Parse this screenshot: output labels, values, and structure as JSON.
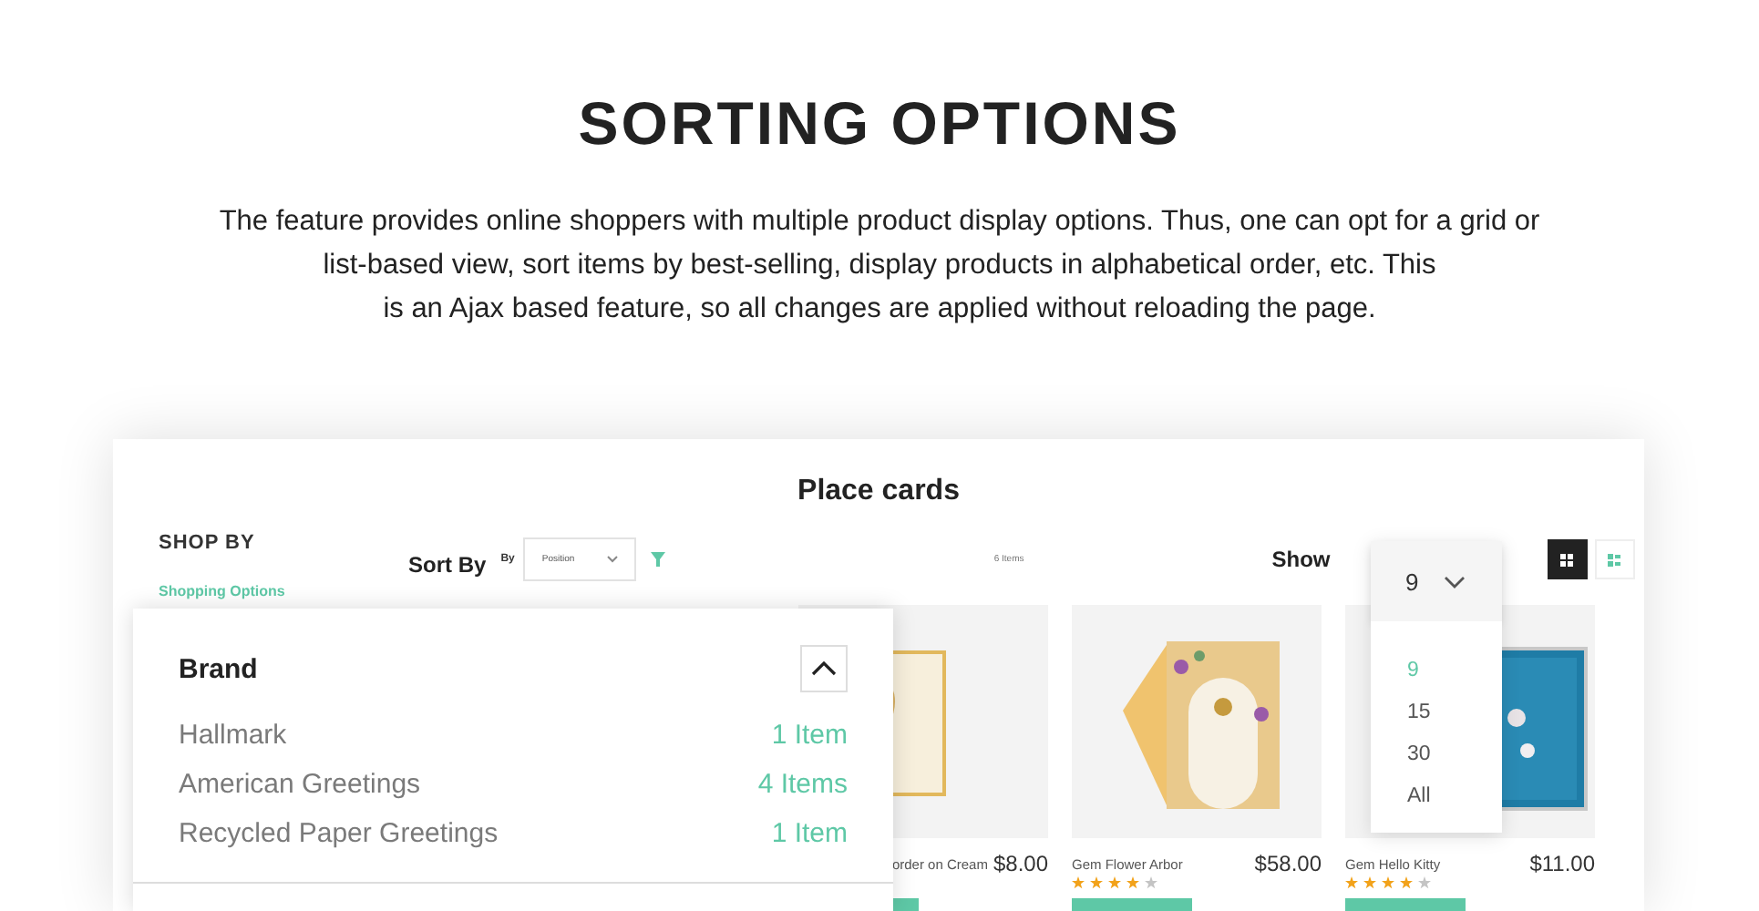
{
  "hero": {
    "title": "SORTING OPTIONS",
    "description_lines": [
      "The feature provides online shoppers with multiple product display options. Thus, one can opt for a grid or",
      "list-based view, sort items by best-selling, display products in alphabetical order, etc. This",
      "is an Ajax based feature, so all changes are applied without reloading the page."
    ]
  },
  "shop": {
    "title": "Place cards",
    "sidebar": {
      "title": "SHOP BY",
      "subtitle": "Shopping Options"
    },
    "toolbar": {
      "sort_label": "Sort By",
      "by_label": "By",
      "sort_value": "Position",
      "item_count": "6 Items",
      "show_label": "Show",
      "view_modes": [
        {
          "kind": "grid",
          "selected": true
        },
        {
          "kind": "list",
          "selected": false
        }
      ]
    },
    "limit": {
      "value": "9",
      "expanded": true,
      "options": [
        {
          "label": "9",
          "selected": true
        },
        {
          "label": "15",
          "selected": false
        },
        {
          "label": "30",
          "selected": false
        },
        {
          "label": "All",
          "selected": false
        }
      ]
    },
    "brand_filter": {
      "title": "Brand",
      "expanded": true,
      "items": [
        {
          "name": "Hallmark",
          "count": "1 Item"
        },
        {
          "name": "American Greetings",
          "count": "4 Items"
        },
        {
          "name": "Recycled Paper Greetings",
          "count": "1 Item"
        }
      ]
    },
    "products": [
      {
        "name": "order on Cream",
        "price": "$8.00"
      },
      {
        "name": "Gem Flower Arbor",
        "price": "$58.00",
        "stars": 4
      },
      {
        "name": "Gem Hello Kitty",
        "price": "$11.00",
        "stars": 4
      }
    ]
  }
}
